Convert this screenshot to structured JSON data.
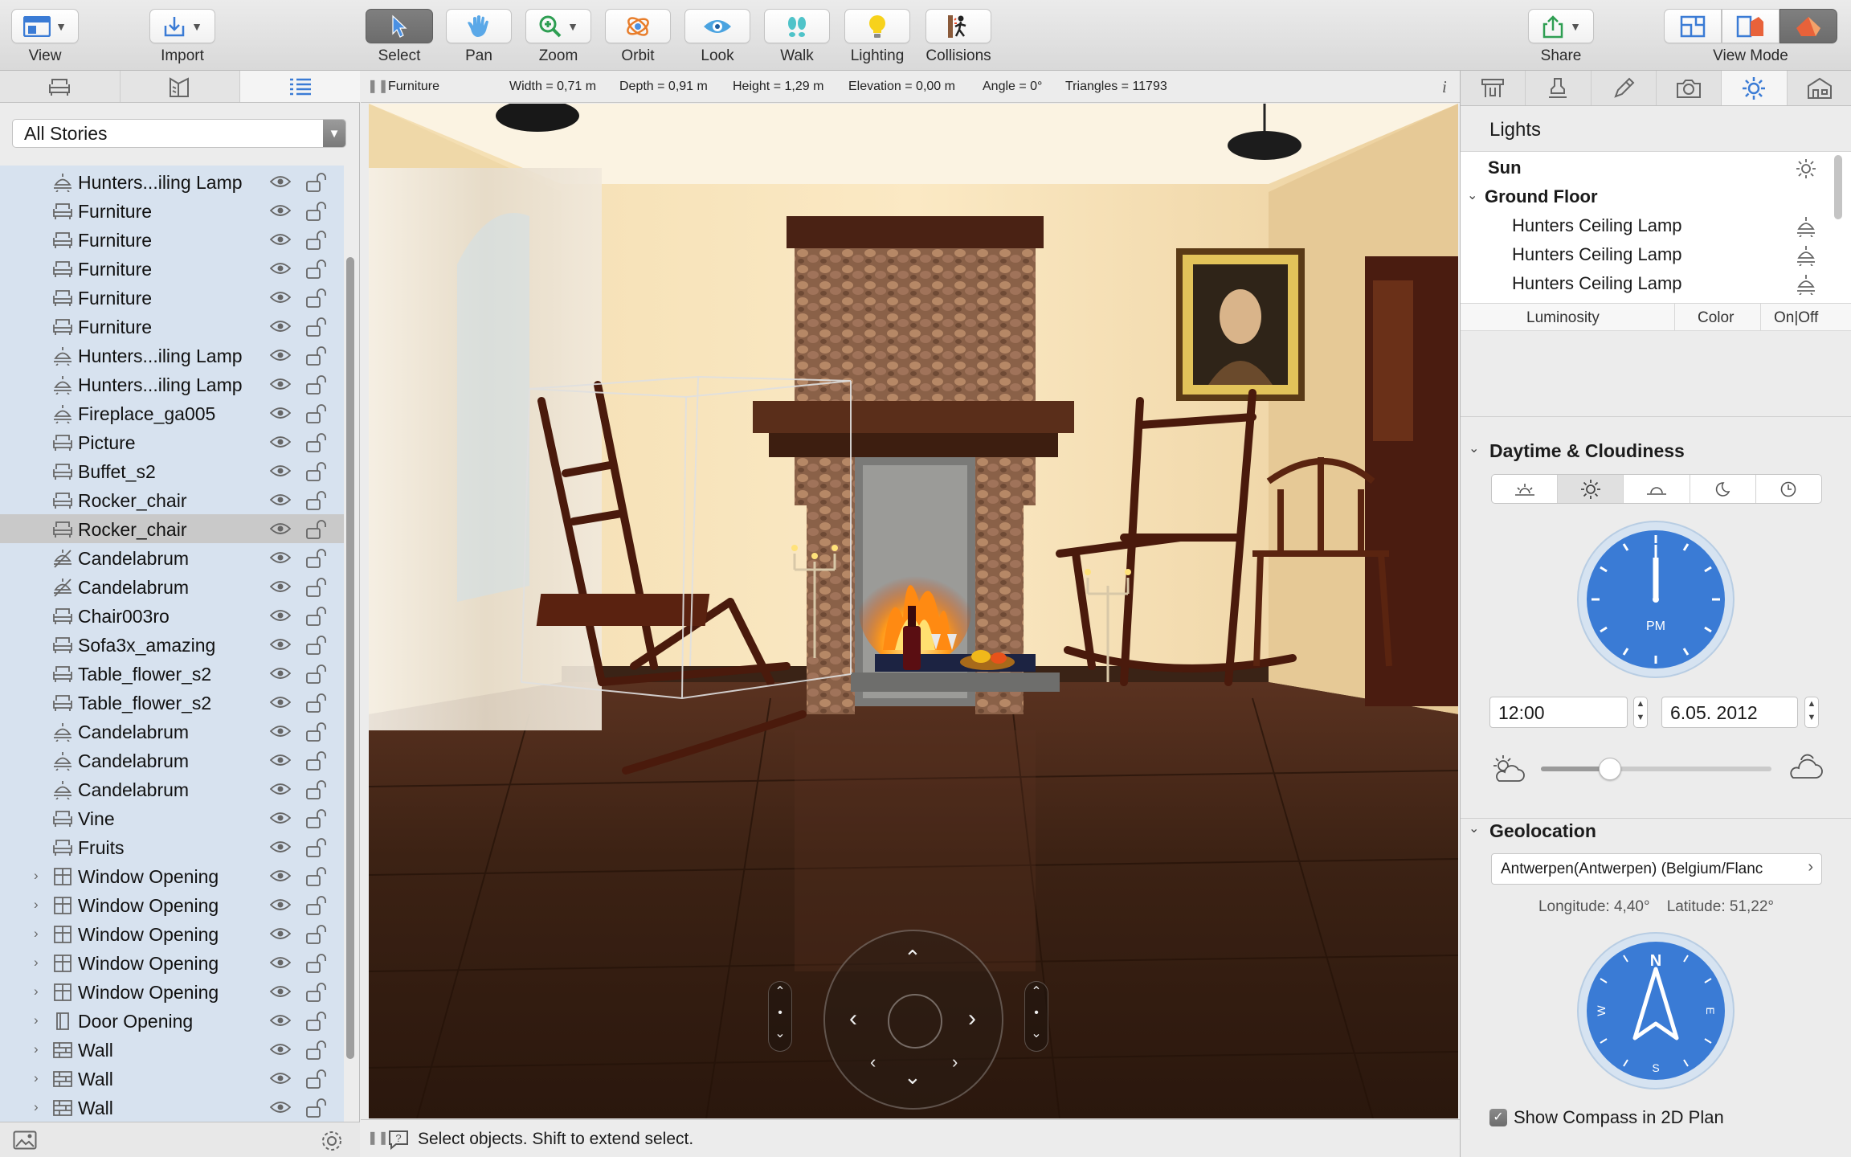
{
  "toolbar": {
    "view": "View",
    "import": "Import",
    "select": "Select",
    "pan": "Pan",
    "zoom": "Zoom",
    "orbit": "Orbit",
    "look": "Look",
    "walk": "Walk",
    "lighting": "Lighting",
    "collisions": "Collisions",
    "share": "Share",
    "view_mode": "View Mode"
  },
  "left_panel": {
    "tabs": [
      "furniture-icon",
      "plan-icon",
      "list-icon"
    ],
    "story_select": "All Stories",
    "items": [
      {
        "icon": "lamp-icon",
        "label": "Hunters...iling Lamp",
        "disclosure": false
      },
      {
        "icon": "furniture-icon",
        "label": "Furniture",
        "disclosure": false
      },
      {
        "icon": "furniture-icon",
        "label": "Furniture",
        "disclosure": false
      },
      {
        "icon": "furniture-icon",
        "label": "Furniture",
        "disclosure": false
      },
      {
        "icon": "furniture-icon",
        "label": "Furniture",
        "disclosure": false
      },
      {
        "icon": "furniture-icon",
        "label": "Furniture",
        "disclosure": false
      },
      {
        "icon": "lamp-icon",
        "label": "Hunters...iling Lamp",
        "disclosure": false
      },
      {
        "icon": "lamp-icon",
        "label": "Hunters...iling Lamp",
        "disclosure": false
      },
      {
        "icon": "lamp-icon",
        "label": "Fireplace_ga005",
        "disclosure": false
      },
      {
        "icon": "furniture-icon",
        "label": "Picture",
        "disclosure": false
      },
      {
        "icon": "furniture-icon",
        "label": "Buffet_s2",
        "disclosure": false
      },
      {
        "icon": "furniture-icon",
        "label": "Rocker_chair",
        "disclosure": false
      },
      {
        "icon": "furniture-icon",
        "label": "Rocker_chair",
        "disclosure": false,
        "selected": true
      },
      {
        "icon": "lamp-off-icon",
        "label": "Candelabrum",
        "disclosure": false
      },
      {
        "icon": "lamp-off-icon",
        "label": "Candelabrum",
        "disclosure": false
      },
      {
        "icon": "furniture-icon",
        "label": "Chair003ro",
        "disclosure": false
      },
      {
        "icon": "furniture-icon",
        "label": "Sofa3x_amazing",
        "disclosure": false
      },
      {
        "icon": "furniture-icon",
        "label": "Table_flower_s2",
        "disclosure": false
      },
      {
        "icon": "furniture-icon",
        "label": "Table_flower_s2",
        "disclosure": false
      },
      {
        "icon": "lamp-icon",
        "label": "Candelabrum",
        "disclosure": false
      },
      {
        "icon": "lamp-icon",
        "label": "Candelabrum",
        "disclosure": false
      },
      {
        "icon": "lamp-icon",
        "label": "Candelabrum",
        "disclosure": false
      },
      {
        "icon": "furniture-icon",
        "label": "Vine",
        "disclosure": false
      },
      {
        "icon": "furniture-icon",
        "label": "Fruits",
        "disclosure": false
      },
      {
        "icon": "window-icon",
        "label": "Window Opening",
        "disclosure": true
      },
      {
        "icon": "window-icon",
        "label": "Window Opening",
        "disclosure": true
      },
      {
        "icon": "window-icon",
        "label": "Window Opening",
        "disclosure": true
      },
      {
        "icon": "window-icon",
        "label": "Window Opening",
        "disclosure": true
      },
      {
        "icon": "window-icon",
        "label": "Window Opening",
        "disclosure": true
      },
      {
        "icon": "door-icon",
        "label": "Door Opening",
        "disclosure": true
      },
      {
        "icon": "wall-icon",
        "label": "Wall",
        "disclosure": true
      },
      {
        "icon": "wall-icon",
        "label": "Wall",
        "disclosure": true
      },
      {
        "icon": "wall-icon",
        "label": "Wall",
        "disclosure": true
      }
    ]
  },
  "info_bar": {
    "type": "Furniture",
    "width": "Width = 0,71 m",
    "depth": "Depth = 0,91 m",
    "height": "Height = 1,29 m",
    "elevation": "Elevation = 0,00 m",
    "angle": "Angle = 0°",
    "triangles": "Triangles = 11793",
    "info_icon": "i"
  },
  "status": {
    "message": "Select objects. Shift to extend select."
  },
  "right_panel": {
    "lights_title": "Lights",
    "sun_label": "Sun",
    "ground_floor_label": "Ground Floor",
    "lamps": [
      "Hunters Ceiling Lamp",
      "Hunters Ceiling Lamp",
      "Hunters Ceiling Lamp"
    ],
    "columns": {
      "luminosity": "Luminosity",
      "color": "Color",
      "onoff": "On|Off"
    },
    "daytime_title": "Daytime & Cloudiness",
    "clock_label": "PM",
    "time": "12:00",
    "date": "6.05. 2012",
    "cloudiness": 0.3,
    "geolocation_title": "Geolocation",
    "location": "Antwerpen(Antwerpen) (Belgium/Flanc",
    "longitude": "Longitude: 4,40°",
    "latitude": "Latitude: 51,22°",
    "compass_n": "N",
    "compass_s": "S",
    "compass_e": "E",
    "compass_w": "W",
    "show_compass": "Show Compass in 2D Plan",
    "show_compass_checked": true
  },
  "colors": {
    "accent_blue": "#3a7bd5",
    "tree_bg": "#d7e2ef",
    "selection_gray": "#c9c9c9"
  }
}
